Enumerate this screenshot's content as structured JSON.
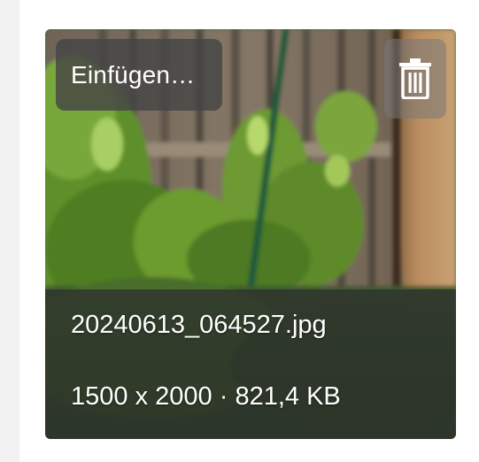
{
  "card": {
    "insert_label": "Einfügen…",
    "filename": "20240613_064527.jpg",
    "dimensions": "1500 x 2000",
    "separator": " · ",
    "filesize": "821,4 KB"
  },
  "icons": {
    "delete": "trash-icon"
  },
  "colors": {
    "button_bg": "#464646",
    "text": "#ffffff"
  }
}
